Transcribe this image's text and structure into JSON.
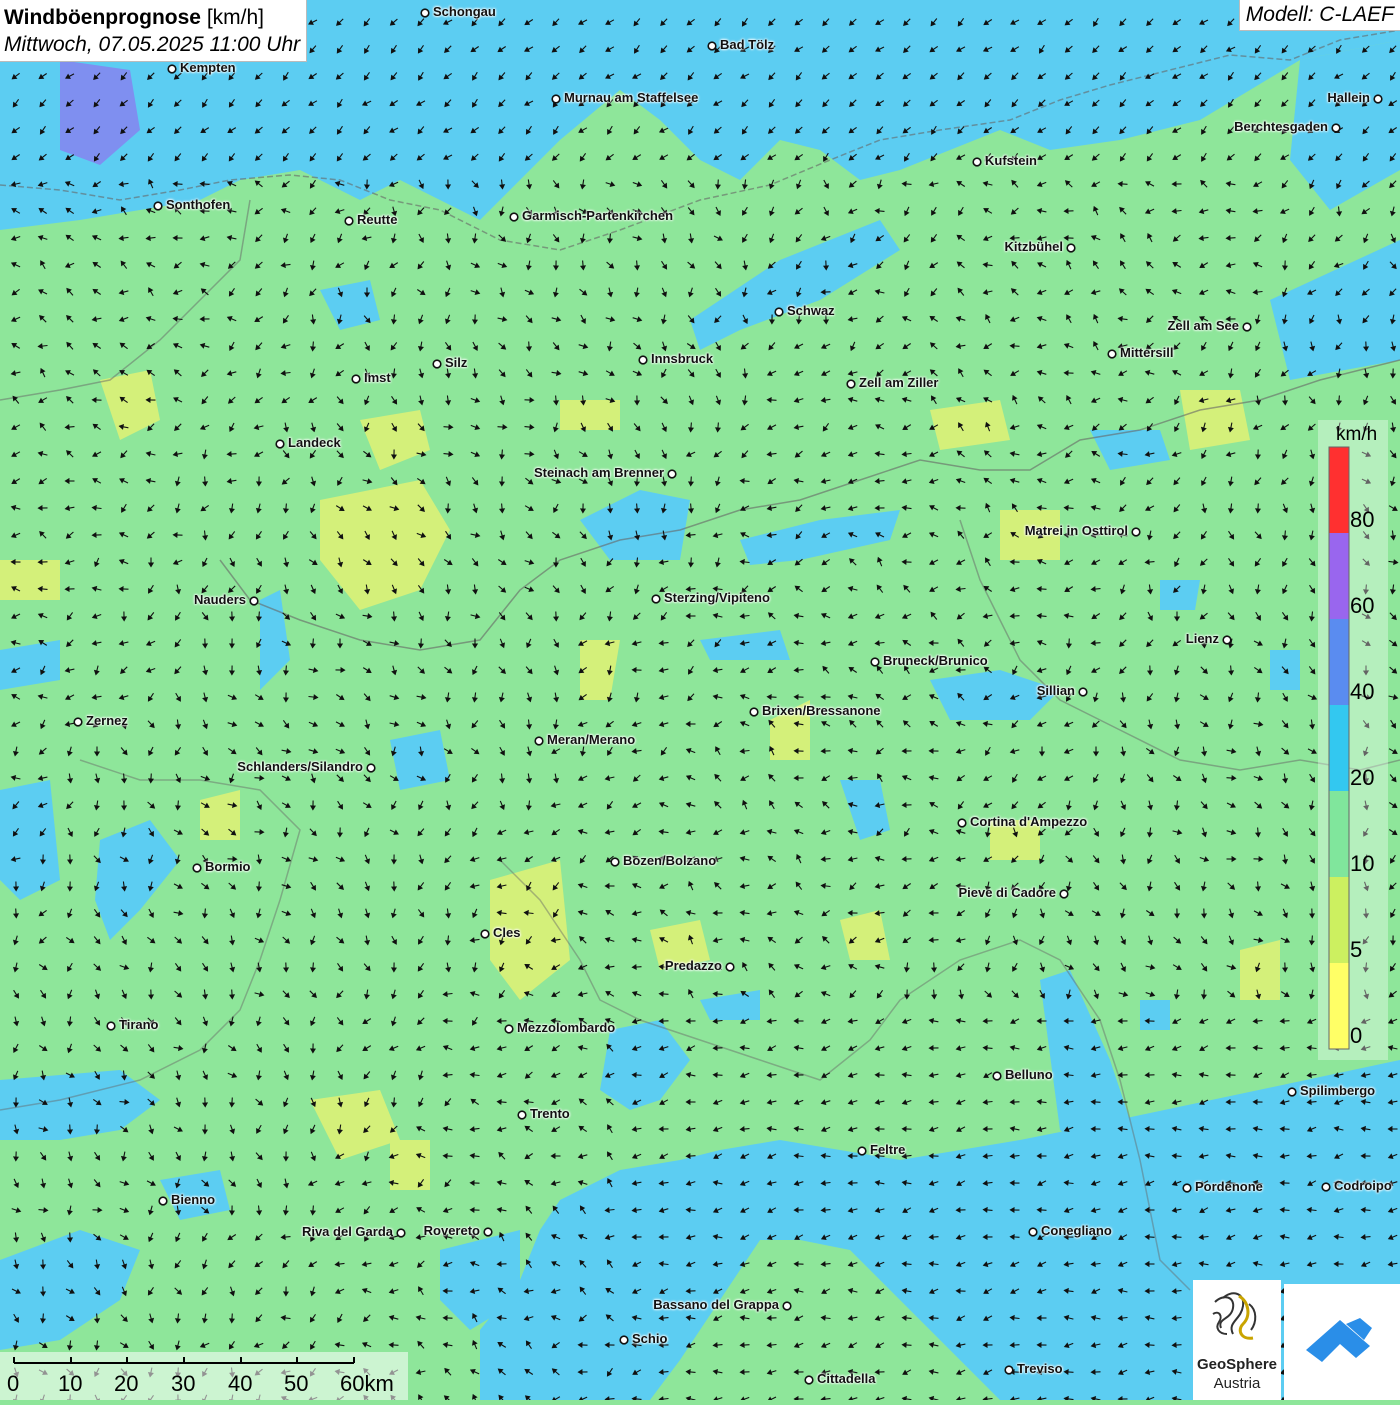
{
  "title": {
    "main": "Windböenprognose",
    "unit": "[km/h]",
    "datetime": "Mittwoch, 07.05.2025 11:00 Uhr"
  },
  "model": "Modell: C-LAEF",
  "legend": {
    "unit": "km/h",
    "labels": [
      "80",
      "60",
      "40",
      "20",
      "10",
      "5",
      "0"
    ],
    "colors": [
      "#ff3030",
      "#9966ee",
      "#5a8cf0",
      "#33c8f0",
      "#80e69c",
      "#ccf060",
      "#ffff66"
    ]
  },
  "scale": {
    "labels": [
      "0",
      "10",
      "20",
      "30",
      "40",
      "50",
      "60km"
    ]
  },
  "logo": {
    "line1": "GeoSphere",
    "line2": "Austria"
  },
  "cities": [
    {
      "name": "Schongau",
      "align": "r"
    },
    {
      "name": "Bad Tölz",
      "align": "r"
    },
    {
      "name": "Kempten",
      "align": "r"
    },
    {
      "name": "Murnau am Staffelsee",
      "align": "r"
    },
    {
      "name": "Hallein",
      "align": "l"
    },
    {
      "name": "Berchtesgaden",
      "align": "l"
    },
    {
      "name": "Kufstein",
      "align": "r"
    },
    {
      "name": "Sonthofen",
      "align": "r"
    },
    {
      "name": "Reutte",
      "align": "r"
    },
    {
      "name": "Garmisch-Partenkirchen",
      "align": "r"
    },
    {
      "name": "Kitzbühel",
      "align": "l"
    },
    {
      "name": "Schwaz",
      "align": "r"
    },
    {
      "name": "Zell am See",
      "align": "l"
    },
    {
      "name": "Mittersill",
      "align": "r"
    },
    {
      "name": "Innsbruck",
      "align": "r"
    },
    {
      "name": "Silz",
      "align": "r"
    },
    {
      "name": "Imst",
      "align": "r"
    },
    {
      "name": "Zell am Ziller",
      "align": "r"
    },
    {
      "name": "Landeck",
      "align": "r"
    },
    {
      "name": "Steinach am Brenner",
      "align": "l"
    },
    {
      "name": "Matrei in Osttirol",
      "align": "l"
    },
    {
      "name": "Nauders",
      "align": "l"
    },
    {
      "name": "Sterzing/Vipiteno",
      "align": "r"
    },
    {
      "name": "Lienz",
      "align": "l"
    },
    {
      "name": "Bruneck/Brunico",
      "align": "r"
    },
    {
      "name": "Sillian",
      "align": "l"
    },
    {
      "name": "Brixen/Bressanone",
      "align": "r"
    },
    {
      "name": "Zernez",
      "align": "r"
    },
    {
      "name": "Meran/Merano",
      "align": "r"
    },
    {
      "name": "Schlanders/Silandro",
      "align": "l"
    },
    {
      "name": "Cortina d'Ampezzo",
      "align": "r"
    },
    {
      "name": "Bozen/Bolzano",
      "align": "r"
    },
    {
      "name": "Bormio",
      "align": "r"
    },
    {
      "name": "Pieve di Cadore",
      "align": "l"
    },
    {
      "name": "Cles",
      "align": "r"
    },
    {
      "name": "Predazzo",
      "align": "l"
    },
    {
      "name": "Tirano",
      "align": "r"
    },
    {
      "name": "Mezzolombardo",
      "align": "r"
    },
    {
      "name": "Belluno",
      "align": "r"
    },
    {
      "name": "Spilimbergo",
      "align": "r"
    },
    {
      "name": "Trento",
      "align": "r"
    },
    {
      "name": "Feltre",
      "align": "r"
    },
    {
      "name": "Pordenone",
      "align": "r"
    },
    {
      "name": "Codroipo",
      "align": "r"
    },
    {
      "name": "Bienno",
      "align": "r"
    },
    {
      "name": "Riva del Garda",
      "align": "l"
    },
    {
      "name": "Rovereto",
      "align": "l"
    },
    {
      "name": "Conegliano",
      "align": "r"
    },
    {
      "name": "Bassano del Grappa",
      "align": "l"
    },
    {
      "name": "Schio",
      "align": "r"
    },
    {
      "name": "Treviso",
      "align": "r"
    },
    {
      "name": "Cittadella",
      "align": "r"
    }
  ]
}
